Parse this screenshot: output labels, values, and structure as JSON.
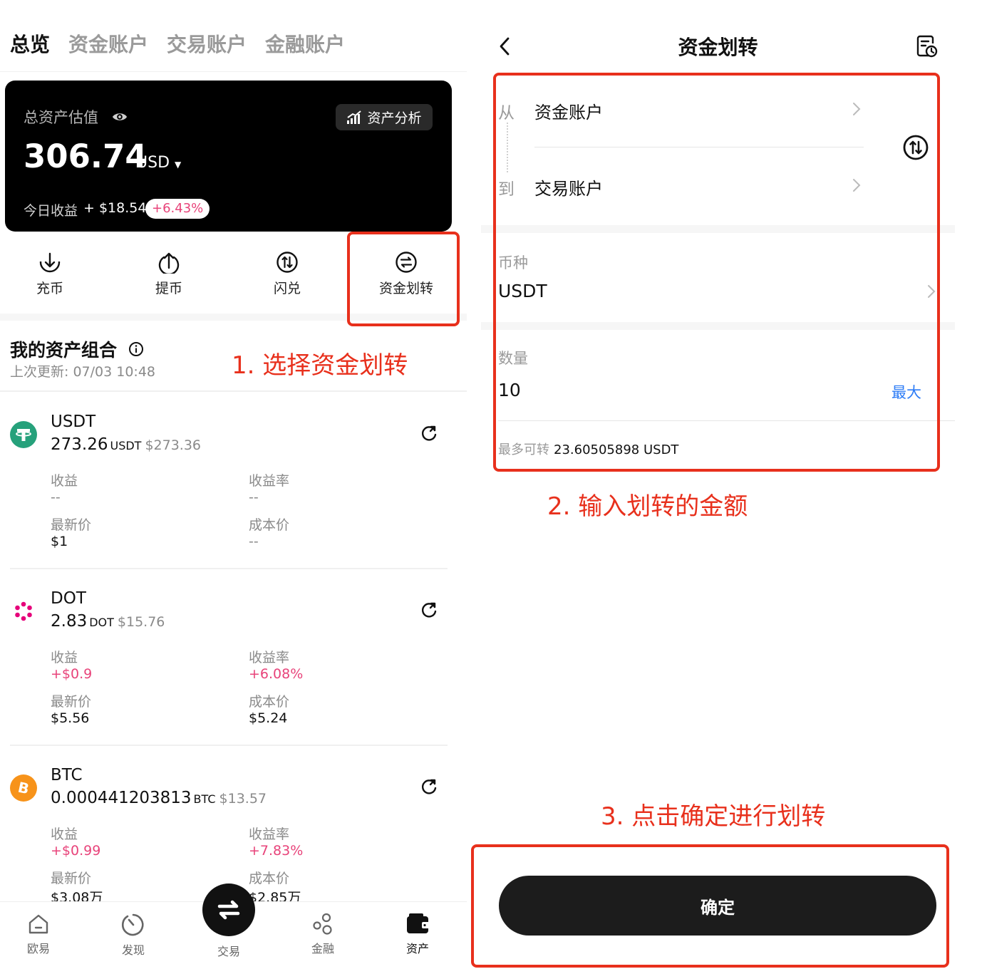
{
  "left": {
    "tabs": [
      "总览",
      "资金账户",
      "交易账户",
      "金融账户"
    ],
    "card": {
      "label": "总资产估值",
      "analysis_label": "资产分析",
      "total": "306.74",
      "unit": "USD",
      "today_label": "今日收益",
      "today_value": "+ $18.54",
      "today_pct": "+6.43%"
    },
    "actions": [
      {
        "label": "充币",
        "icon": "deposit-icon"
      },
      {
        "label": "提币",
        "icon": "withdraw-icon"
      },
      {
        "label": "闪兑",
        "icon": "swap-icon"
      },
      {
        "label": "资金划转",
        "icon": "transfer-icon"
      }
    ],
    "portfolio": {
      "title": "我的资产组合",
      "updated": "上次更新: 07/03 10:48"
    },
    "assets": [
      {
        "symbol": "USDT",
        "amount": "273.26",
        "unit": "USDT",
        "usd": "$273.36",
        "pnl_label": "收益",
        "pnl": "--",
        "rate_label": "收益率",
        "rate": "--",
        "price_label": "最新价",
        "price": "$1",
        "cost_label": "成本价",
        "cost": "--",
        "logo_color": "#26a17b"
      },
      {
        "symbol": "DOT",
        "amount": "2.83",
        "unit": "DOT",
        "usd": "$15.76",
        "pnl_label": "收益",
        "pnl": "+$0.9",
        "rate_label": "收益率",
        "rate": "+6.08%",
        "price_label": "最新价",
        "price": "$5.56",
        "cost_label": "成本价",
        "cost": "$5.24",
        "logo_color": "#e6007a"
      },
      {
        "symbol": "BTC",
        "amount": "0.000441203813",
        "unit": "BTC",
        "usd": "$13.57",
        "pnl_label": "收益",
        "pnl": "+$0.99",
        "rate_label": "收益率",
        "rate": "+7.83%",
        "price_label": "最新价",
        "price": "$3.08万",
        "cost_label": "成本价",
        "cost": "$2.85万",
        "logo_color": "#f7931a"
      }
    ],
    "bottom_nav": [
      "欧易",
      "发现",
      "交易",
      "金融",
      "资产"
    ]
  },
  "right": {
    "title": "资金划转",
    "from_label": "从",
    "from_value": "资金账户",
    "to_label": "到",
    "to_value": "交易账户",
    "currency_label": "币种",
    "currency_value": "USDT",
    "qty_label": "数量",
    "qty_value": "10",
    "max_label": "最大",
    "avail_label": "最多可转",
    "avail_value": "23.60505898 USDT",
    "confirm_label": "确定"
  },
  "annotations": {
    "step1": "1. 选择资金划转",
    "step2": "2. 输入划转的金额",
    "step3": "3. 点击确定进行划转",
    "color": "#e8301c"
  },
  "colors": {
    "positive": "#e8437a",
    "link": "#2d7cf6",
    "dark": "#111111"
  }
}
